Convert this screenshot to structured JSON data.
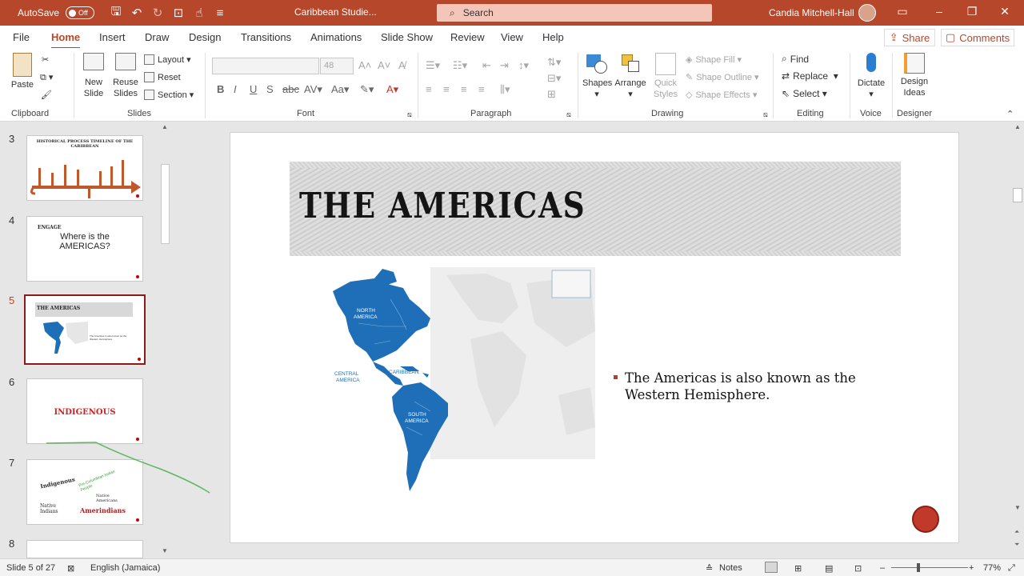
{
  "titlebar": {
    "autosave_label": "AutoSave",
    "autosave_state": "Off",
    "document_title": "Caribbean Studie...",
    "search_label": "Search",
    "user_name": "Candia Mitchell-Hall"
  },
  "menu": {
    "tabs": [
      "File",
      "Home",
      "Insert",
      "Draw",
      "Design",
      "Transitions",
      "Animations",
      "Slide Show",
      "Review",
      "View",
      "Help"
    ],
    "active_tab": "Home",
    "share_label": "Share",
    "comments_label": "Comments"
  },
  "ribbon": {
    "clipboard": {
      "label": "Clipboard",
      "paste": "Paste"
    },
    "slides": {
      "label": "Slides",
      "new_slide_1": "New",
      "new_slide_2": "Slide",
      "reuse_1": "Reuse",
      "reuse_2": "Slides",
      "layout": "Layout",
      "reset": "Reset",
      "section": "Section"
    },
    "font": {
      "label": "Font",
      "size": "48"
    },
    "paragraph": {
      "label": "Paragraph"
    },
    "drawing": {
      "label": "Drawing",
      "shapes": "Shapes",
      "arrange": "Arrange",
      "quick_1": "Quick",
      "quick_2": "Styles",
      "shape_fill": "Shape Fill",
      "shape_outline": "Shape Outline",
      "shape_effects": "Shape Effects"
    },
    "editing": {
      "label": "Editing",
      "find": "Find",
      "replace": "Replace",
      "select": "Select"
    },
    "voice": {
      "label": "Voice",
      "dictate": "Dictate"
    },
    "designer": {
      "label": "Designer",
      "design_1": "Design",
      "design_2": "Ideas"
    }
  },
  "thumbnails": [
    {
      "num": "3",
      "title_1": "HISTORICAL PROCESS TIMELINE OF THE",
      "title_2": "CARIBBEAN"
    },
    {
      "num": "4",
      "small": "ENGAGE",
      "text_1": "Where is the",
      "text_2": "AMERICAS?"
    },
    {
      "num": "5",
      "title": "THE AMERICAS"
    },
    {
      "num": "6",
      "text": "INDIGENOUS"
    },
    {
      "num": "7",
      "w1": "Indigenous",
      "w2": "Pre-Columbian Indian People",
      "w3": "Native Americans",
      "w4": "Native Indians",
      "w5": "Amerindians"
    },
    {
      "num": "8"
    }
  ],
  "slide": {
    "title": "THE AMERICAS",
    "bullet": "The Americas is also known as the Western Hemisphere.",
    "map_labels": {
      "north": "NORTH\nAMERICA",
      "central": "CENTRAL\nAMERICA",
      "caribbean": "CARIBBEAN",
      "south": "SOUTH\nAMERICA"
    }
  },
  "status": {
    "slide_info": "Slide 5 of 27",
    "language": "English (Jamaica)",
    "notes": "Notes",
    "zoom": "77%"
  },
  "colors": {
    "accent": "#b7472a",
    "map_blue": "#1f6fb8"
  }
}
